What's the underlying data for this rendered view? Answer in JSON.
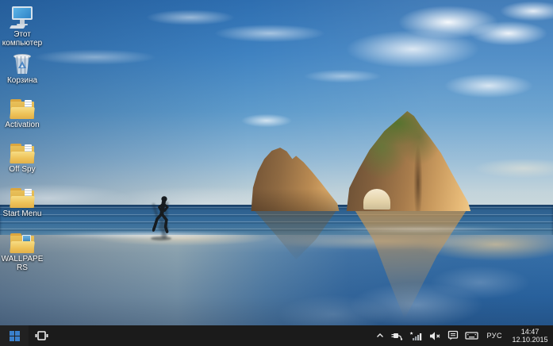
{
  "desktop": {
    "icons": [
      {
        "label": "Этот компьютер"
      },
      {
        "label": "Корзина"
      },
      {
        "label": "Activation"
      },
      {
        "label": "Off Spy"
      },
      {
        "label": "Start Menu"
      },
      {
        "label": "WALLPAPERS"
      }
    ]
  },
  "taskbar": {
    "language_indicator": "РУС",
    "clock": {
      "time": "14:47",
      "date": "12.10.2015"
    },
    "tray_icons": [
      "show-hidden-icons-chevron",
      "safely-remove-hardware",
      "network",
      "volume",
      "action-center",
      "touch-keyboard"
    ]
  },
  "colors": {
    "taskbar_bg": "#1b1b1b",
    "start_logo_blue": "#3a80cc",
    "folder_yellow": "#eec157",
    "sky_blue": "#3f82c1",
    "sea_blue": "#336a99",
    "rock_gold": "#c99a5e"
  }
}
